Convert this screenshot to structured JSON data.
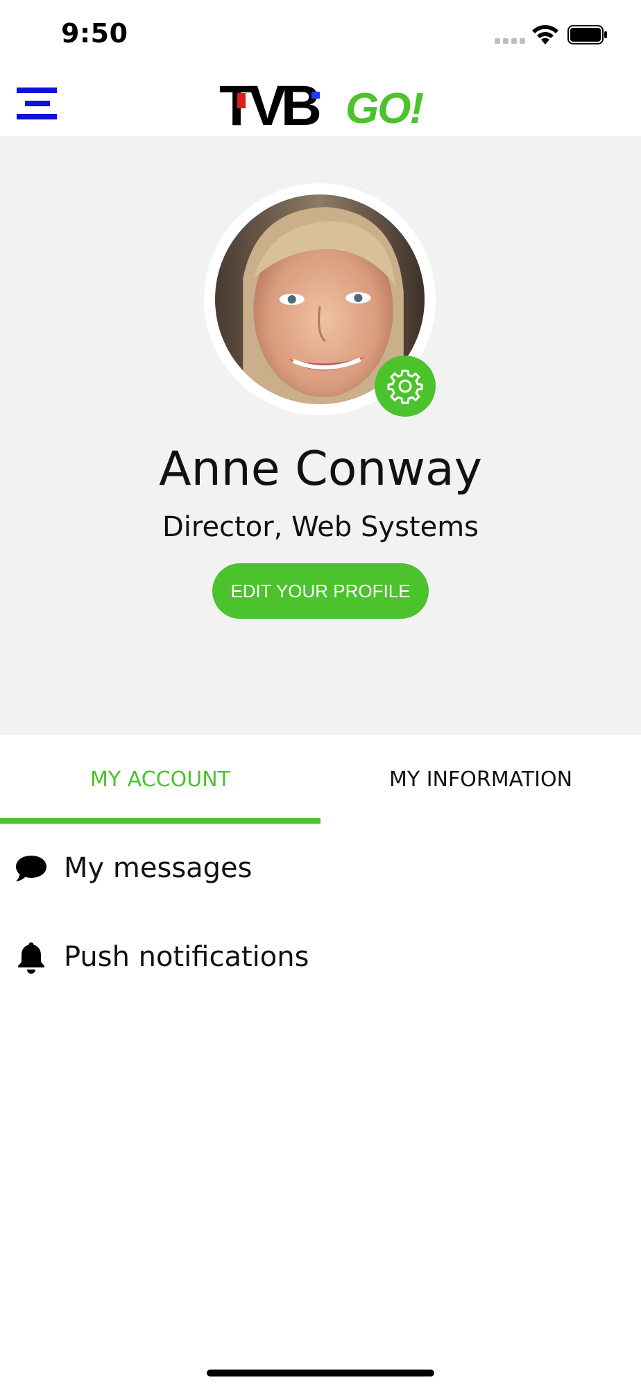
{
  "status_bar": {
    "time": "9:50",
    "icons": [
      "signal-dots-icon",
      "wifi-icon",
      "battery-icon"
    ]
  },
  "header": {
    "menu_icon": "hamburger-menu-icon",
    "logo": {
      "brand": "TVB",
      "suffix": "GO!"
    }
  },
  "colors": {
    "accent": "#4cc22c",
    "menu_icon": "#1010e0",
    "profile_background": "#f2f2f2"
  },
  "profile": {
    "name": "Anne Conway",
    "title": "Director, Web Systems",
    "edit_button_label": "EDIT YOUR PROFILE",
    "settings_icon": "gear-icon"
  },
  "tabs": [
    {
      "label": "MY ACCOUNT",
      "active": true
    },
    {
      "label": "MY INFORMATION",
      "active": false
    }
  ],
  "menu": {
    "items": [
      {
        "label": "My messages",
        "icon": "chat-bubble-icon"
      },
      {
        "label": "Push notifications",
        "icon": "bell-icon"
      }
    ]
  }
}
